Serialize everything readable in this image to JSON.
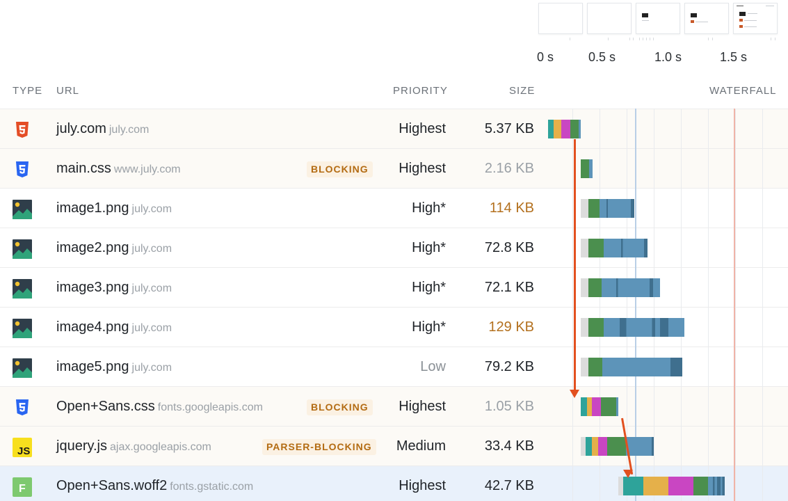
{
  "filmstrip": {
    "frames": [
      "blank",
      "blank",
      "partial-content",
      "partial-content",
      "full-content"
    ]
  },
  "timeline": {
    "labels": [
      "0 s",
      "0.5 s",
      "1.0 s",
      "1.5 s"
    ]
  },
  "columns": {
    "type": "TYPE",
    "url": "URL",
    "priority": "PRIORITY",
    "size": "SIZE",
    "waterfall": "WATERFALL"
  },
  "rows": [
    {
      "icon": "html5-icon",
      "name": "july.com",
      "domain": "july.com",
      "badge": "",
      "priority": "Highest",
      "size": "5.37 KB",
      "size_style": "normal"
    },
    {
      "icon": "css3-icon",
      "name": "main.css",
      "domain": "www.july.com",
      "badge": "BLOCKING",
      "priority": "Highest",
      "size": "2.16 KB",
      "size_style": "muted"
    },
    {
      "icon": "image-icon",
      "name": "image1.png",
      "domain": "july.com",
      "badge": "",
      "priority": "High*",
      "size": "114 KB",
      "size_style": "warn"
    },
    {
      "icon": "image-icon",
      "name": "image2.png",
      "domain": "july.com",
      "badge": "",
      "priority": "High*",
      "size": "72.8 KB",
      "size_style": "normal"
    },
    {
      "icon": "image-icon",
      "name": "image3.png",
      "domain": "july.com",
      "badge": "",
      "priority": "High*",
      "size": "72.1 KB",
      "size_style": "normal"
    },
    {
      "icon": "image-icon",
      "name": "image4.png",
      "domain": "july.com",
      "badge": "",
      "priority": "High*",
      "size": "129 KB",
      "size_style": "warn"
    },
    {
      "icon": "image-icon",
      "name": "image5.png",
      "domain": "july.com",
      "badge": "",
      "priority": "Low",
      "size": "79.2 KB",
      "size_style": "normal"
    },
    {
      "icon": "css3-icon",
      "name": "Open+Sans.css",
      "domain": "fonts.googleapis.com",
      "badge": "BLOCKING",
      "priority": "Highest",
      "size": "1.05 KB",
      "size_style": "muted"
    },
    {
      "icon": "js-icon",
      "name": "jquery.js",
      "domain": "ajax.googleapis.com",
      "badge": "PARSER-BLOCKING",
      "priority": "Medium",
      "size": "33.4 KB",
      "size_style": "normal"
    },
    {
      "icon": "font-icon",
      "name": "Open+Sans.woff2",
      "domain": "fonts.gstatic.com",
      "badge": "",
      "priority": "Highest",
      "size": "42.7 KB",
      "size_style": "normal"
    }
  ],
  "colors": {
    "queue": "#dcdcdc",
    "dns": "#2ea39a",
    "connect": "#e5b04a",
    "ssl": "#c946c2",
    "ttfb": "#4b8f4e",
    "download": "#5d94b9",
    "download_dark": "#3f6f8e",
    "blocking_badge": "#b36b12",
    "arrow": "#e2501f"
  }
}
